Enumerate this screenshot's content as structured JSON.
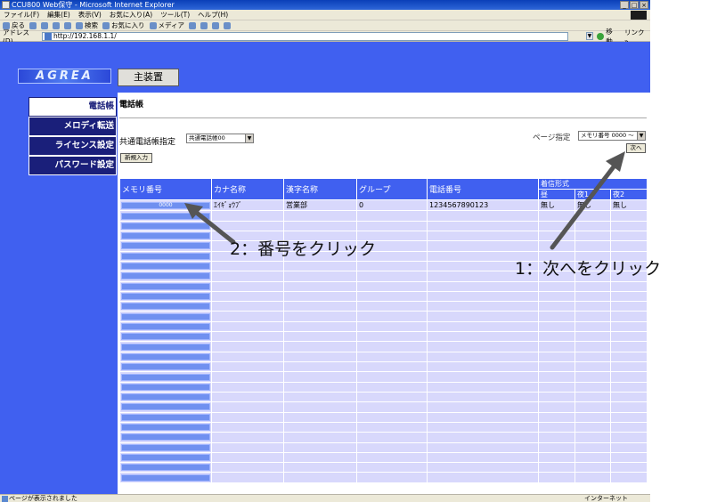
{
  "window": {
    "title": "CCU800 Web保守 - Microsoft Internet Explorer",
    "controls": [
      "_",
      "□",
      "×"
    ]
  },
  "menu": [
    "ファイル(F)",
    "編集(E)",
    "表示(V)",
    "お気に入り(A)",
    "ツール(T)",
    "ヘルプ(H)"
  ],
  "toolbar": {
    "back": "戻る",
    "search": "検索",
    "favorites": "お気に入り",
    "media": "メディア"
  },
  "address": {
    "label": "アドレス(D)",
    "url": "http://192.168.1.1/",
    "go": "移動",
    "links": "リンク »"
  },
  "app": {
    "logo": "AGREA",
    "main_tab": "主装置"
  },
  "sidebar": {
    "items": [
      {
        "label": "電話帳",
        "active": true
      },
      {
        "label": "メロディ転送",
        "active": false
      },
      {
        "label": "ライセンス設定",
        "active": false
      },
      {
        "label": "パスワード設定",
        "active": false
      }
    ]
  },
  "content": {
    "title": "電話帳",
    "common_label": "共通電話帳指定",
    "common_value": "共通電話帳00",
    "new_button": "新規入力",
    "page_label": "ページ指定",
    "page_value": "メモリ番号 0000 ～",
    "next_button": "次へ"
  },
  "table": {
    "headers": {
      "memory": "メモリ番号",
      "kana": "カナ名称",
      "kanji": "漢字名称",
      "group": "グループ",
      "phone": "電話番号",
      "incoming": "着信形式",
      "day": "昼",
      "night1": "夜1",
      "night2": "夜2"
    },
    "first_row": {
      "memory": "0000",
      "kana": "ｴｲｷﾞｮｳﾌﾞ",
      "kanji": "営業部",
      "group": "0",
      "phone": "1234567890123",
      "day": "無し",
      "night1": "無し",
      "night2": "無し"
    },
    "empty_rows": 27
  },
  "annotations": {
    "step1": "1：次へをクリック",
    "step2": "2：番号をクリック"
  },
  "status": {
    "left": "ページが表示されました",
    "zone": "インターネット"
  },
  "colors": {
    "blue_band": "#4060f0",
    "nav_dark": "#1a1f7a",
    "cell_fill": "#d8d8fc",
    "number_button": "#7090f0"
  }
}
